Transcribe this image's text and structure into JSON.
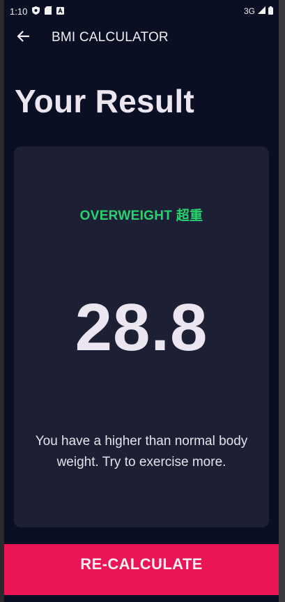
{
  "status_bar": {
    "time": "1:10",
    "network": "3G",
    "icons": [
      "shield-icon",
      "sd-card-icon",
      "notification-a-icon",
      "signal-icon",
      "battery-icon"
    ]
  },
  "app_bar": {
    "title": "BMI CALCULATOR",
    "back_icon": "arrow-back-icon"
  },
  "main": {
    "heading": "Your Result"
  },
  "result": {
    "status": "OVERWEIGHT 超重",
    "bmi": "28.8",
    "advice": "You have a higher than normal body weight. Try to exercise more."
  },
  "actions": {
    "recalculate_label": "RE-CALCULATE"
  },
  "colors": {
    "background": "#0b0f24",
    "card": "#1d1f35",
    "status_green": "#27d36f",
    "accent": "#eb1555"
  }
}
